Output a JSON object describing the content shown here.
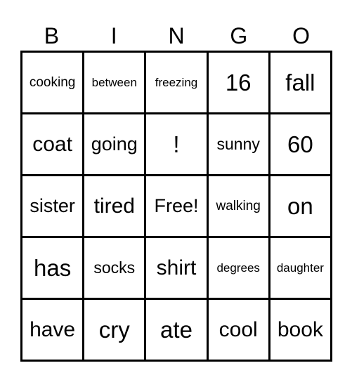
{
  "header": {
    "letters": [
      "B",
      "I",
      "N",
      "G",
      "O"
    ]
  },
  "card": {
    "rows": [
      [
        "cooking",
        "between",
        "freezing",
        "16",
        "fall"
      ],
      [
        "coat",
        "going",
        "!",
        "sunny",
        "60"
      ],
      [
        "sister",
        "tired",
        "Free!",
        "walking",
        "on"
      ],
      [
        "has",
        "socks",
        "shirt",
        "degrees",
        "daughter"
      ],
      [
        "have",
        "cry",
        "ate",
        "cool",
        "book"
      ]
    ],
    "free_space": "Free!"
  }
}
